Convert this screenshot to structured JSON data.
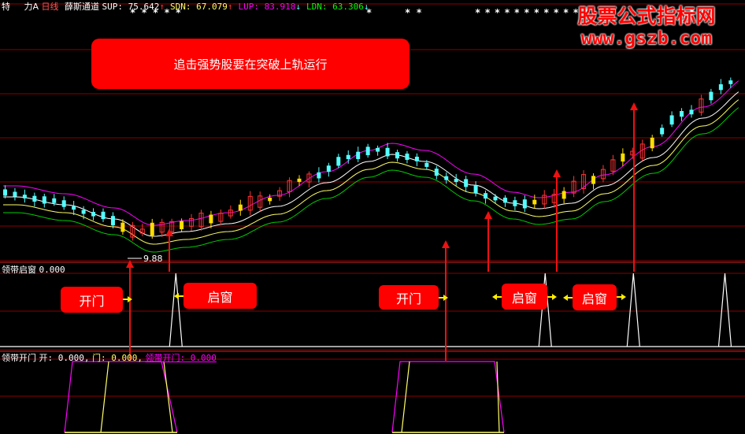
{
  "header": {
    "chars": [
      "特",
      "力A",
      "日线"
    ],
    "indicator_name": "薛斯通道",
    "sup_label": "SUP: 75.642",
    "sdn_label": "SDN: 67.079",
    "lup_label": "LUP: 83.918",
    "ldn_label": "LDN: 63.306",
    "stars_1": "* * * * *",
    "stars_2": "*",
    "stars_3": "* *",
    "stars_4": "* * * * * * * * * * * *",
    "stars_5": "* *"
  },
  "colors": {
    "up": "#ff3333",
    "down": "#54ffff",
    "signal": "#ffdd00",
    "sup": "#ffffff",
    "sdn": "#ffff66",
    "lup": "#ff00ff",
    "ldn": "#00cc00",
    "pane_line": "#ffffff",
    "grid": "#8b0000"
  },
  "main_banner": {
    "text": "追击强势股要在突破上轨运行"
  },
  "min_label": "9.88",
  "watermark": {
    "line1": "股票公式指标网",
    "line2": "www.gszb.com"
  },
  "pane2": {
    "title": "领带启窗",
    "value": "0.000",
    "labels": {
      "open_door": "开门",
      "open_window": "启窗"
    }
  },
  "pane3": {
    "title": "领带开门",
    "k_label": "开: 0.000,",
    "m_label": "门: 0.000,",
    "l_label": "领带开门: 0.000"
  },
  "chart_data": [
    {
      "type": "candlestick",
      "series": [
        {
          "name": "SUP",
          "value": 75.642
        },
        {
          "name": "SDN",
          "value": 67.079
        },
        {
          "name": "LUP",
          "value": 83.918
        },
        {
          "name": "LDN",
          "value": 63.306
        }
      ]
    },
    {
      "type": "line",
      "title": "领带启窗",
      "value": 0.0,
      "spikes": [
        {
          "bar": 62,
          "value": 1
        },
        {
          "bar": 175,
          "value": 1
        },
        {
          "bar": 202,
          "value": 1
        },
        {
          "bar": 230,
          "value": 1
        }
      ]
    },
    {
      "type": "line",
      "title": "领带开门",
      "values": {
        "开": 0.0,
        "门": 0.0,
        "领带开门": 0.0
      },
      "segments": [
        {
          "start": 23,
          "end": 64,
          "value": 1
        },
        {
          "start": 145,
          "end": 184,
          "value": 1
        }
      ]
    }
  ]
}
